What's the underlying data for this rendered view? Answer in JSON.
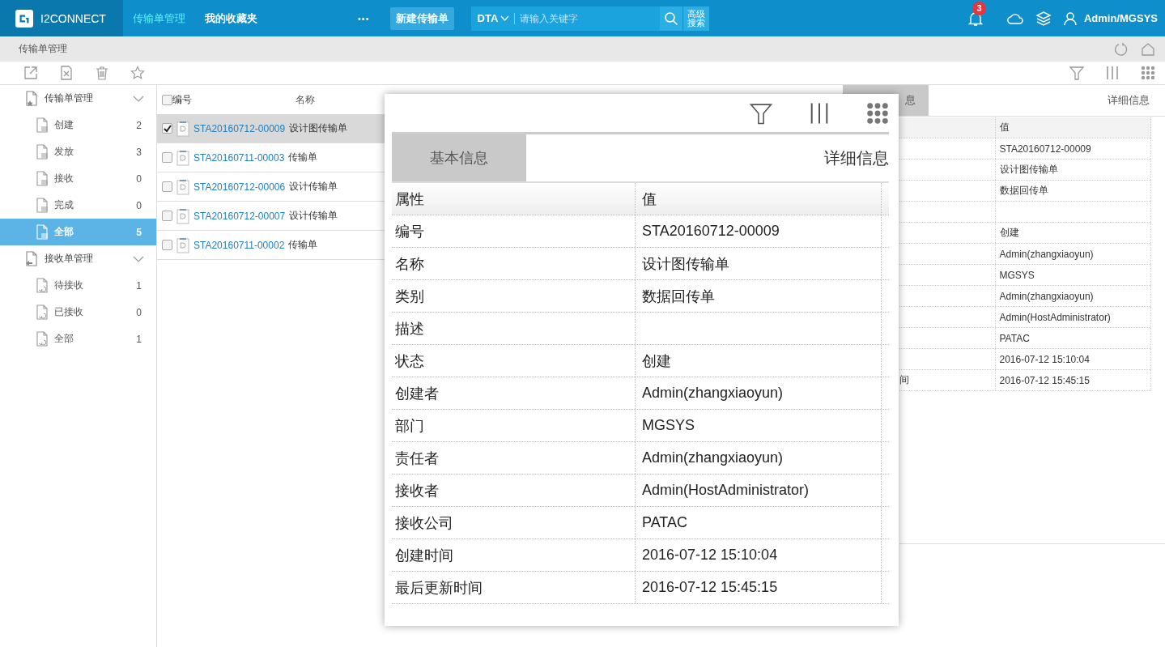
{
  "top_bar": {
    "logo": "I2CONNECT",
    "nav": [
      {
        "label": "传输单管理",
        "selected": true
      },
      {
        "label": "我的收藏夹",
        "selected": false
      }
    ],
    "more": "•••",
    "new_button": "新建传输单",
    "search": {
      "scope": "DTA",
      "placeholder": "请输入关键字"
    },
    "advanced_search": "高级搜索",
    "notification_count": "3",
    "user": "Admin/MGSYS"
  },
  "breadcrumb": "传输单管理",
  "sidebar": {
    "groups": [
      {
        "label": "传输单管理",
        "kind": "send",
        "expanded": true,
        "children": [
          {
            "label": "创建",
            "count": "2",
            "selected": false
          },
          {
            "label": "发放",
            "count": "3",
            "selected": false
          },
          {
            "label": "接收",
            "count": "0",
            "selected": false
          },
          {
            "label": "完成",
            "count": "0",
            "selected": false
          },
          {
            "label": "全部",
            "count": "5",
            "selected": true
          }
        ]
      },
      {
        "label": "接收单管理",
        "kind": "receive",
        "expanded": true,
        "children": [
          {
            "label": "待接收",
            "count": "1",
            "selected": false
          },
          {
            "label": "已接收",
            "count": "0",
            "selected": false
          },
          {
            "label": "全部",
            "count": "1",
            "selected": false
          }
        ]
      }
    ]
  },
  "list": {
    "select_all_checked": false,
    "columns": [
      "编号",
      "名称"
    ],
    "rows": [
      {
        "id": "STA20160712-00009",
        "name": "设计图传输单",
        "checked": true,
        "selected": true
      },
      {
        "id": "STA20160711-00003",
        "name": "传输单",
        "checked": false,
        "selected": false
      },
      {
        "id": "STA20160712-00006",
        "name": "设计传输单",
        "checked": false,
        "selected": false
      },
      {
        "id": "STA20160712-00007",
        "name": "设计传输单",
        "checked": false,
        "selected": false
      },
      {
        "id": "STA20160711-00002",
        "name": "传输单",
        "checked": false,
        "selected": false
      }
    ]
  },
  "detail_panel": {
    "tabs": [
      {
        "label": "息",
        "selected": false
      },
      {
        "label": "详细信息",
        "selected": true
      }
    ],
    "value_header": "值",
    "rows": [
      {
        "value": "STA20160712-00009"
      },
      {
        "value": "设计图传输单"
      },
      {
        "value": "数据回传单"
      },
      {},
      {
        "value": "创建"
      },
      {
        "value": "Admin(zhangxiaoyun)"
      },
      {
        "value": "MGSYS"
      },
      {
        "value": "Admin(zhangxiaoyun)"
      },
      {
        "value": "Admin(HostAdministrator)"
      },
      {
        "value": "PATAC"
      },
      {
        "value": "2016-07-12 15:10:04"
      },
      {
        "property": "间",
        "value": "2016-07-12 15:45:15"
      }
    ]
  },
  "zoom_popup": {
    "tabs": [
      {
        "label": "基本信息",
        "selected": false
      },
      {
        "label": "详细信息",
        "selected": true
      }
    ],
    "columns": [
      "属性",
      "值"
    ],
    "rows": [
      {
        "property": "编号",
        "value": "STA20160712-00009"
      },
      {
        "property": "名称",
        "value": "设计图传输单"
      },
      {
        "property": "类别",
        "value": "数据回传单"
      },
      {
        "property": "描述"
      },
      {
        "property": "状态",
        "value": "创建"
      },
      {
        "property": "创建者",
        "value": "Admin(zhangxiaoyun)"
      },
      {
        "property": "部门",
        "value": "MGSYS"
      },
      {
        "property": "责任者",
        "value": "Admin(zhangxiaoyun)"
      },
      {
        "property": "接收者",
        "value": "Admin(HostAdministrator)"
      },
      {
        "property": "接收公司",
        "value": "PATAC"
      },
      {
        "property": "创建时间",
        "value": "2016-07-12 15:10:04"
      },
      {
        "property": "最后更新时间",
        "value": "2016-07-12 15:45:15"
      }
    ]
  }
}
